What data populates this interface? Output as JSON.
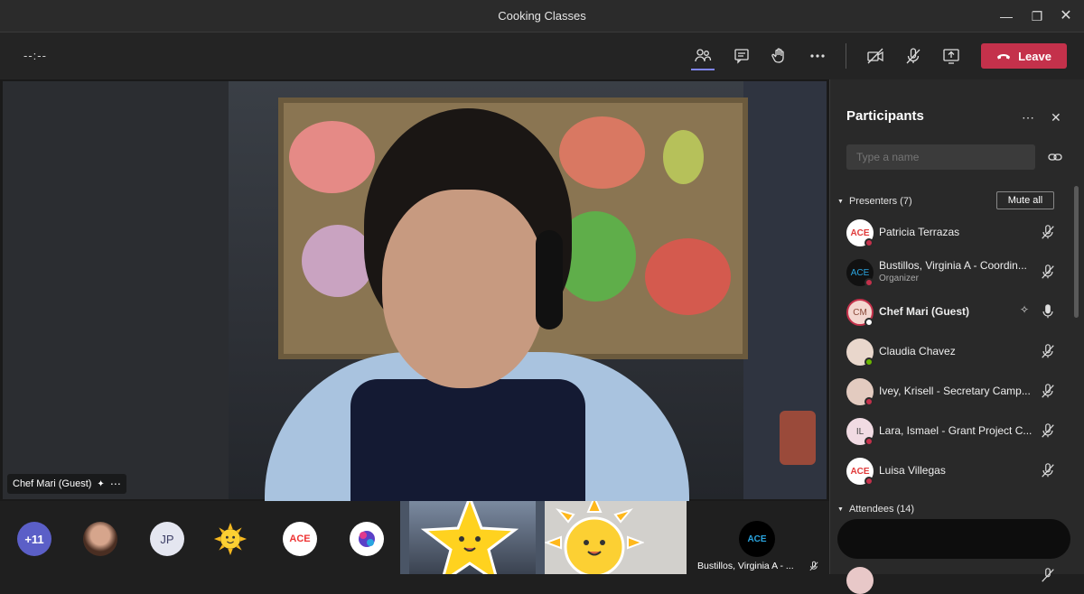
{
  "window": {
    "title": "Cooking Classes"
  },
  "toolbar": {
    "timer": "--:--",
    "leave_label": "Leave",
    "icons": [
      "people-icon",
      "chat-icon",
      "raise-hand-icon",
      "more-icon",
      "camera-off-icon",
      "mic-off-icon",
      "share-screen-icon",
      "phone-hangup-icon"
    ]
  },
  "stage": {
    "speaker_name": "Chef Mari (Guest)"
  },
  "strip": {
    "overflow_count": "+11",
    "jp_initials": "JP",
    "thumb_name": "Bustillos, Virginia A - ..."
  },
  "panel": {
    "title": "Participants",
    "search_placeholder": "Type a name",
    "presenters_label": "Presenters (7)",
    "mute_all_label": "Mute all",
    "attendees_label": "Attendees (14)",
    "presenters": [
      {
        "name": "Patricia Terrazas",
        "sub": "",
        "initials": "ACE",
        "status": "#c4314b"
      },
      {
        "name": "Bustillos, Virginia A - Coordin...",
        "sub": "Organizer",
        "initials": "ACE",
        "status": "#c4314b"
      },
      {
        "name": "Chef Mari (Guest)",
        "sub": "",
        "initials": "CM",
        "status": "#ffffff"
      },
      {
        "name": "Claudia Chavez",
        "sub": "",
        "initials": "",
        "status": "#6bb700"
      },
      {
        "name": "Ivey, Krisell - Secretary Camp...",
        "sub": "",
        "initials": "",
        "status": "#c4314b"
      },
      {
        "name": "Lara, Ismael - Grant Project C...",
        "sub": "",
        "initials": "IL",
        "status": "#c4314b"
      },
      {
        "name": "Luisa Villegas",
        "sub": "",
        "initials": "ACE",
        "status": "#c4314b"
      }
    ]
  },
  "colors": {
    "leave": "#c4314b",
    "accent": "#7f85f5"
  }
}
